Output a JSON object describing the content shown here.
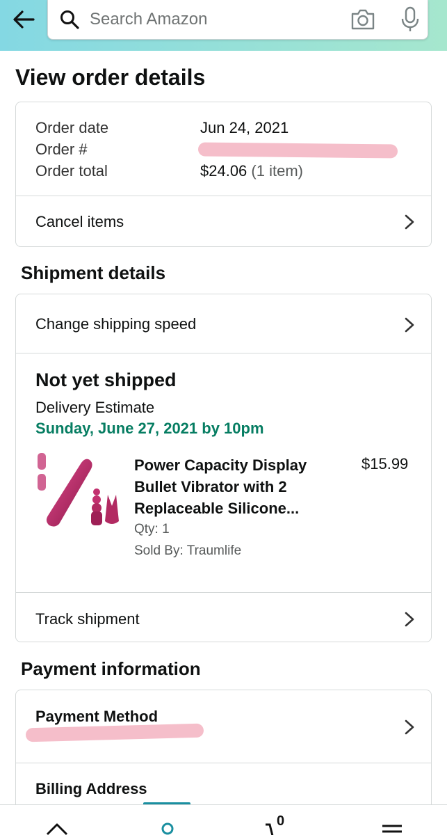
{
  "search": {
    "placeholder": "Search Amazon",
    "icons": [
      "back-arrow-icon",
      "search-icon",
      "camera-icon",
      "microphone-icon"
    ]
  },
  "page": {
    "title": "View order details"
  },
  "order_summary": {
    "rows": [
      {
        "label": "Order date",
        "value": "Jun 24, 2021"
      },
      {
        "label": "Order #",
        "value": ""
      },
      {
        "label": "Order total",
        "value": "$24.06",
        "extra": "(1 item)"
      }
    ],
    "cancel_label": "Cancel items"
  },
  "shipment": {
    "section_title": "Shipment details",
    "change_speed_label": "Change shipping speed",
    "status": "Not yet shipped",
    "estimate_label": "Delivery Estimate",
    "estimate_date": "Sunday, June 27, 2021 by 10pm",
    "item": {
      "title": "Power Capacity Display Bullet Vibrator with 2 Replaceable Silicone...",
      "price": "$15.99",
      "qty": "Qty: 1",
      "seller": "Sold By: Traumlife"
    },
    "track_label": "Track shipment"
  },
  "payment": {
    "section_title": "Payment information",
    "method_label": "Payment Method",
    "billing_label": "Billing Address"
  },
  "colors": {
    "header_gradient_start": "#84d8e3",
    "header_gradient_end": "#a6e7ce",
    "delivery_green": "#067d62",
    "nav_accent": "#1a8fa0",
    "redaction_pink": "#f4b9c6"
  },
  "bottom_nav": {
    "icons": [
      "home-icon",
      "account-icon",
      "cart-icon",
      "menu-icon"
    ],
    "cart_count": "0"
  }
}
